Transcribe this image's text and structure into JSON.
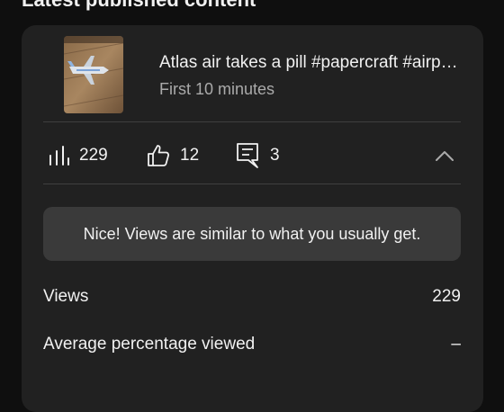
{
  "section": {
    "title": "Latest published content"
  },
  "video": {
    "title": "Atlas air takes a pill #papercraft #airplane",
    "subtitle": "First 10 minutes"
  },
  "stats": {
    "views": "229",
    "likes": "12",
    "comments": "3"
  },
  "insight": {
    "message": "Nice! Views are similar to what you usually get."
  },
  "metrics": [
    {
      "label": "Views",
      "value": "229"
    },
    {
      "label": "Average percentage viewed",
      "value": "–"
    }
  ],
  "icons": {
    "views": "bar-chart-icon",
    "likes": "thumb-up-icon",
    "comments": "comment-icon",
    "collapse": "chevron-up-icon"
  },
  "colors": {
    "background": "#0f0f0f",
    "card": "#212121",
    "message_bg": "#3a3a3a",
    "text": "#f1f1f1",
    "secondary_text": "#aaaaaa",
    "divider": "#3f3f3f"
  }
}
